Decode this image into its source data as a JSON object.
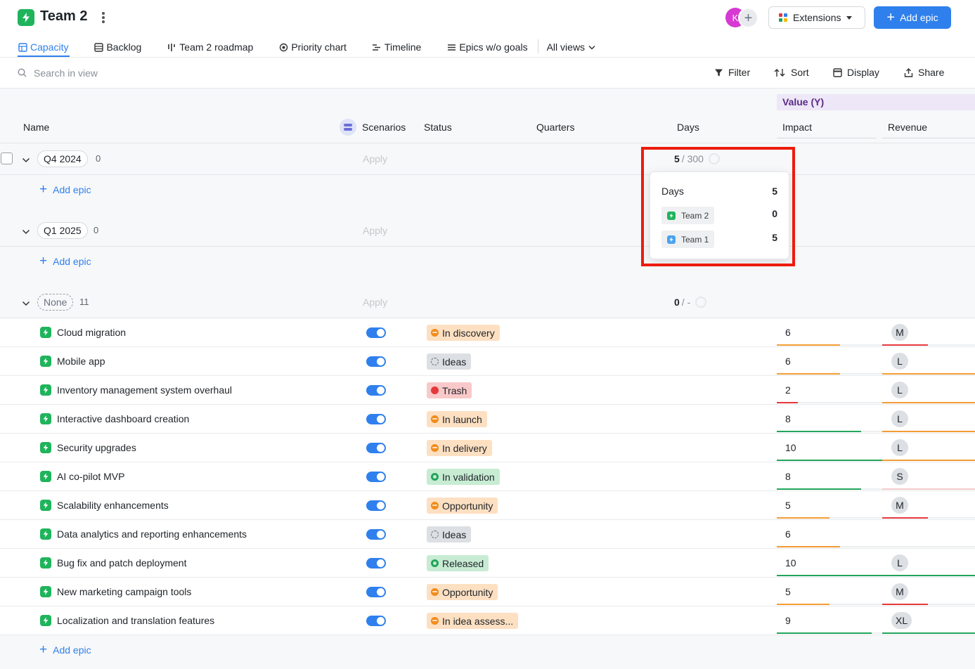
{
  "header": {
    "title": "Team 2",
    "avatar_initial": "K",
    "extensions_label": "Extensions",
    "add_epic_label": "Add epic"
  },
  "tabs": [
    {
      "label": "Capacity",
      "icon": "table-icon",
      "active": true
    },
    {
      "label": "Backlog",
      "icon": "list-icon"
    },
    {
      "label": "Team 2 roadmap",
      "icon": "roadmap-icon"
    },
    {
      "label": "Priority chart",
      "icon": "target-icon"
    },
    {
      "label": "Timeline",
      "icon": "timeline-icon"
    },
    {
      "label": "Epics w/o goals",
      "icon": "lines-icon"
    },
    {
      "label": "All views",
      "icon": "chevron-down-icon"
    }
  ],
  "toolbar": {
    "search_placeholder": "Search in view",
    "filter_label": "Filter",
    "sort_label": "Sort",
    "display_label": "Display",
    "share_label": "Share"
  },
  "columns": {
    "value_group": "Value (Y)",
    "name": "Name",
    "scenarios": "Scenarios",
    "status": "Status",
    "quarters": "Quarters",
    "days": "Days",
    "impact": "Impact",
    "revenue": "Revenue"
  },
  "groups": [
    {
      "label": "Q4 2024",
      "count": "0",
      "apply": "Apply",
      "days_used": "5",
      "days_capacity": "/ 300",
      "add_label": "Add epic"
    },
    {
      "label": "Q1 2025",
      "count": "0",
      "apply": "Apply",
      "add_label": "Add epic"
    },
    {
      "label": "None",
      "count": "11",
      "apply": "Apply",
      "days_used": "0",
      "days_capacity": "/ -",
      "add_label": "Add epic"
    }
  ],
  "epics": [
    {
      "name": "Cloud migration",
      "status": "In discovery",
      "status_kind": "orange",
      "impact": "6",
      "impact_pct": 0.6,
      "impact_color": "#f39c34",
      "revenue": "M",
      "revenue_pct": 0.5,
      "revenue_color": "#e5383b"
    },
    {
      "name": "Mobile app",
      "status": "Ideas",
      "status_kind": "grey",
      "impact": "6",
      "impact_pct": 0.6,
      "impact_color": "#f39c34",
      "revenue": "L",
      "revenue_pct": 1.0,
      "revenue_color": "#f39c34"
    },
    {
      "name": "Inventory management system overhaul",
      "status": "Trash",
      "status_kind": "red",
      "impact": "2",
      "impact_pct": 0.2,
      "impact_color": "#e5383b",
      "revenue": "L",
      "revenue_pct": 1.0,
      "revenue_color": "#f39c34"
    },
    {
      "name": "Interactive dashboard creation",
      "status": "In launch",
      "status_kind": "orange",
      "impact": "8",
      "impact_pct": 0.8,
      "impact_color": "#22a55a",
      "revenue": "L",
      "revenue_pct": 1.0,
      "revenue_color": "#f39c34"
    },
    {
      "name": "Security upgrades",
      "status": "In delivery",
      "status_kind": "orange",
      "impact": "10",
      "impact_pct": 1.0,
      "impact_color": "#22a55a",
      "revenue": "L",
      "revenue_pct": 1.0,
      "revenue_color": "#f39c34"
    },
    {
      "name": "AI co-pilot MVP",
      "status": "In validation",
      "status_kind": "green",
      "impact": "8",
      "impact_pct": 0.8,
      "impact_color": "#22a55a",
      "revenue": "S",
      "revenue_pct": 1.0,
      "revenue_color": "#f3c9c9"
    },
    {
      "name": "Scalability enhancements",
      "status": "Opportunity",
      "status_kind": "orange",
      "impact": "5",
      "impact_pct": 0.5,
      "impact_color": "#f39c34",
      "revenue": "M",
      "revenue_pct": 0.5,
      "revenue_color": "#e5383b"
    },
    {
      "name": "Data analytics and reporting enhancements",
      "status": "Ideas",
      "status_kind": "grey",
      "impact": "6",
      "impact_pct": 0.6,
      "impact_color": "#f39c34",
      "revenue": "",
      "revenue_pct": 0,
      "revenue_color": "#eceef0"
    },
    {
      "name": "Bug fix and patch deployment",
      "status": "Released",
      "status_kind": "green",
      "impact": "10",
      "impact_pct": 1.0,
      "impact_color": "#22a55a",
      "revenue": "L",
      "revenue_pct": 1.0,
      "revenue_color": "#22a55a"
    },
    {
      "name": "New marketing campaign tools",
      "status": "Opportunity",
      "status_kind": "orange",
      "impact": "5",
      "impact_pct": 0.5,
      "impact_color": "#f39c34",
      "revenue": "M",
      "revenue_pct": 0.5,
      "revenue_color": "#e5383b"
    },
    {
      "name": "Localization and translation features",
      "status": "In idea assess...",
      "status_kind": "orange",
      "impact": "9",
      "impact_pct": 0.9,
      "impact_color": "#22a55a",
      "revenue": "XL",
      "revenue_pct": 1.0,
      "revenue_color": "#22a55a"
    }
  ],
  "popover": {
    "title": "Days",
    "total": "5",
    "teams": [
      {
        "name": "Team 2",
        "value": "0",
        "color": "#1fb45c"
      },
      {
        "name": "Team 1",
        "value": "5",
        "color": "#4aa3f0"
      }
    ]
  },
  "colors": {
    "accent": "#2f80ed",
    "highlight": "#ec1c0e"
  }
}
